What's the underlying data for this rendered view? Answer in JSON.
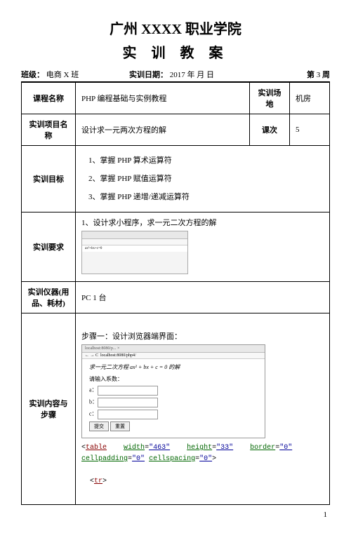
{
  "title_line1": "广州 XXXX 职业学院",
  "title_line2": "实 训 教 案",
  "header": {
    "class_label": "班级：",
    "class_value": "电商 X 班",
    "date_label": "实训日期：",
    "date_value": "2017  年    月   日",
    "week_label": "第",
    "week_num": "3",
    "week_suffix": "周"
  },
  "rows": {
    "course_label": "课程名称",
    "course_value": "PHP 编程基础与实例教程",
    "venue_label": "实训场地",
    "venue_value": "机房",
    "project_label": "实训项目名称",
    "project_value": "设计求一元两次方程的解",
    "lesson_label": "课次",
    "lesson_value": "5",
    "goal_label": "实训目标",
    "goals": [
      "1、掌握 PHP 算术运算符",
      "2、掌握 PHP 赋值运算符",
      "3、掌握 PHP 递增/递减运算符"
    ],
    "req_label": "实训要求",
    "req_line": "1、设计求小程序，求一元二次方程的解",
    "equip_label": "实训仪器(用品、耗材)",
    "equip_value": "PC 1 台",
    "steps_label": "实训内容与步骤",
    "step1": "步骤一：设计浏览器端界面：",
    "browser_tab": "localhost:8080/p...",
    "browser_url": "localhost",
    "equation": "求一元二次方程 ax² + bx + c = 0 的解",
    "input_hint": "请输入系数：",
    "a_label": "a：",
    "b_label": "b：",
    "c_label": "c：",
    "btn_submit": "提交",
    "btn_reset": "重置",
    "code": {
      "table": "table",
      "width_a": "width",
      "width_v": "\"463\"",
      "height_a": "height",
      "height_v": "\"33\"",
      "border_a": "border",
      "border_v": "\"0\"",
      "cellp_a": "cellpadding",
      "cellp_v": "\"0\"",
      "cells_a": "cellspacing",
      "cells_v": "\"0\"",
      "tr": "tr"
    }
  },
  "page_number": "1"
}
